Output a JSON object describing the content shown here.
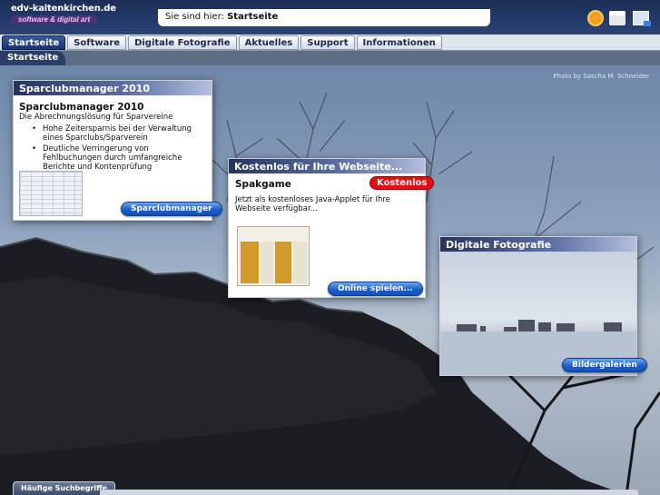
{
  "header": {
    "logo_title": "edv-kaltenkirchen.de",
    "logo_subtitle": "software & digital art",
    "breadcrumb_prefix": "Sie sind hier: ",
    "breadcrumb_current": "Startseite",
    "icons": [
      "sun-icon",
      "printer-icon",
      "mail-icon"
    ]
  },
  "nav": {
    "tabs": [
      {
        "label": "Startseite",
        "active": true
      },
      {
        "label": "Software",
        "active": false
      },
      {
        "label": "Digitale Fotografie",
        "active": false
      },
      {
        "label": "Aktuelles",
        "active": false
      },
      {
        "label": "Support",
        "active": false
      },
      {
        "label": "Informationen",
        "active": false
      }
    ],
    "subtab": "Startseite"
  },
  "photo_credit": "Photo by Sascha M. Schneider",
  "cards": {
    "sparclub": {
      "header": "Sparclubmanager 2010",
      "title": "Sparclubmanager 2010",
      "intro": "Die Abrechnungslösung für Sparvereine",
      "bullets": [
        "Hohe Zeitersparnis bei der Verwaltung eines Sparclubs/Sparverein",
        "Deutliche Verringerung von Fehlbuchungen durch umfangreiche Berichte und Kontenprüfung"
      ],
      "button": "Sparclubmanager"
    },
    "spakgame": {
      "header": "Kostenlos für Ihre Webseite...",
      "title": "Spakgame",
      "badge": "Kostenlos",
      "text": "Jetzt als kostenloses Java-Applet für Ihre Webseite verfügbar...",
      "button": "Online spielen..."
    },
    "foto": {
      "header": "Digitale Fotografie",
      "button": "Bildergalerien"
    }
  },
  "footer": {
    "tab": "Häufige Suchbegriffe"
  }
}
